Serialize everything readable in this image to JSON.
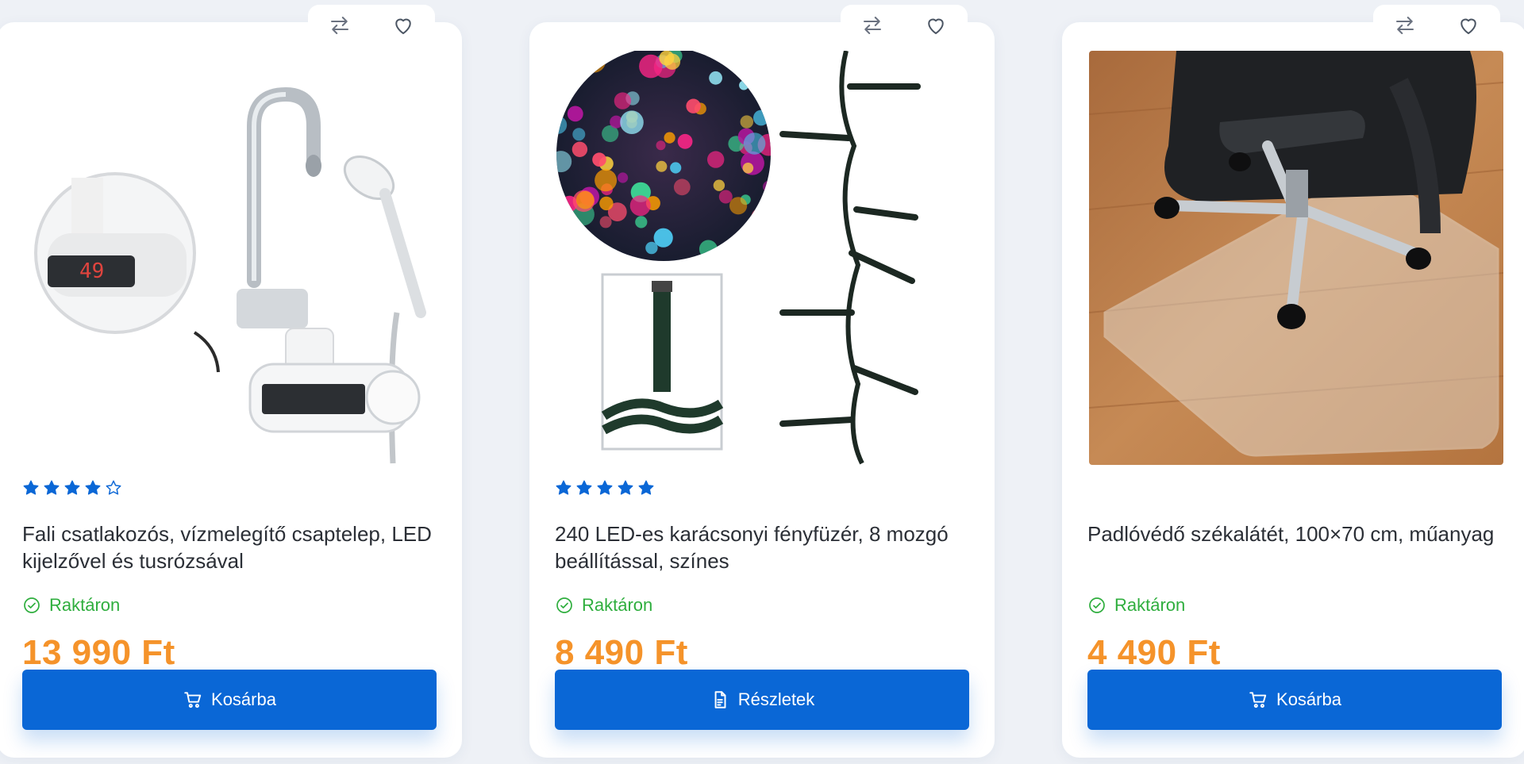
{
  "colors": {
    "accent": "#0a67d6",
    "price": "#f5932a",
    "in_stock": "#2fae3e",
    "star": "#0a67d6"
  },
  "products": [
    {
      "rating": 4,
      "rating_max": 5,
      "title": "Fali csatlakozós, vízmelegítő csaptelep, LED kijelzővel és tusrózsával",
      "stock": "Raktáron",
      "price": "13 990 Ft",
      "button": {
        "label": "Kosárba",
        "icon": "cart-icon"
      },
      "display": "49"
    },
    {
      "rating": 5,
      "rating_max": 5,
      "title": "240 LED-es karácsonyi fényfüzér, 8 mozgó beállítással, színes",
      "stock": "Raktáron",
      "price": "8 490 Ft",
      "button": {
        "label": "Részletek",
        "icon": "document-icon"
      }
    },
    {
      "rating": 0,
      "rating_max": 0,
      "title": "Padlóvédő székalátét, 100×70 cm, műanyag",
      "stock": "Raktáron",
      "price": "4 490 Ft",
      "button": {
        "label": "Kosárba",
        "icon": "cart-icon"
      }
    }
  ]
}
